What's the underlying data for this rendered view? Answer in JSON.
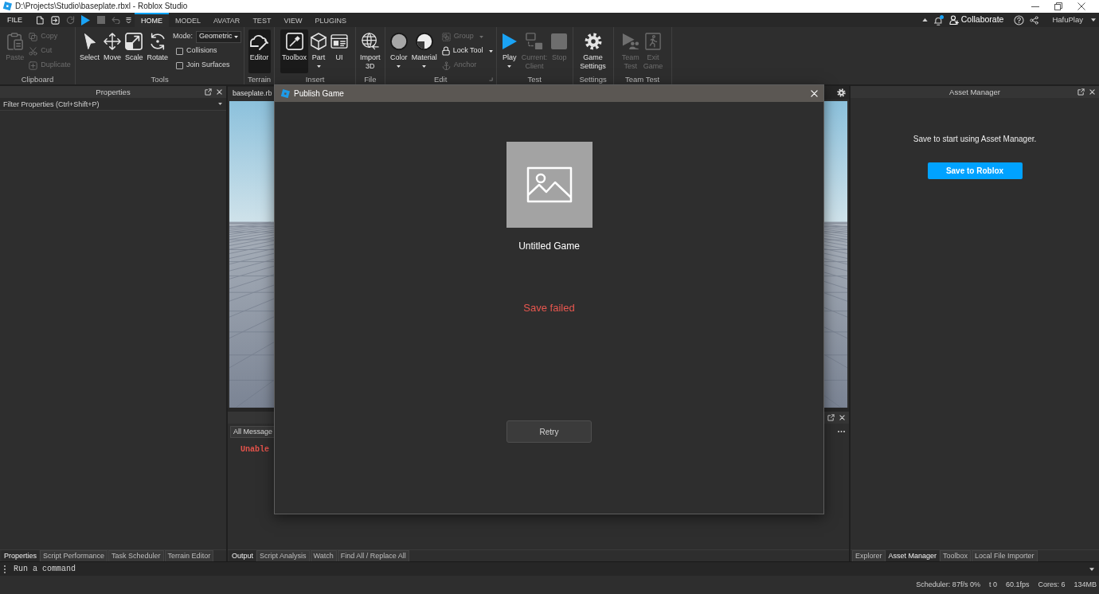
{
  "window": {
    "title": "D:\\Projects\\Studio\\baseplate.rbxl - Roblox Studio"
  },
  "menu_bar": {
    "file_menu": "FILE",
    "quick_access": [
      {
        "disabled": false
      },
      {
        "disabled": false
      },
      {
        "disabled": true
      },
      {
        "disabled": false
      },
      {
        "disabled": true
      },
      {
        "disabled": true
      },
      {
        "disabled": false
      }
    ],
    "tabs": [
      {
        "label": "HOME",
        "selected": true
      },
      {
        "label": "MODEL",
        "selected": false
      },
      {
        "label": "AVATAR",
        "selected": false
      },
      {
        "label": "TEST",
        "selected": false
      },
      {
        "label": "VIEW",
        "selected": false
      },
      {
        "label": "PLUGINS",
        "selected": false
      }
    ],
    "notifications_unread": true,
    "collaborate": "Collaborate",
    "user": "HafuPlay"
  },
  "ribbon": {
    "groups": [
      {
        "label": "Clipboard",
        "launcher": false,
        "items": [
          {
            "kind": "large",
            "label": "Paste",
            "disabled": true,
            "on": false,
            "dropdown": false
          },
          {
            "kind": "stack",
            "items": [
              {
                "kind": "small",
                "label": "Copy",
                "disabled": true,
                "dropdown": false
              },
              {
                "kind": "small",
                "label": "Cut",
                "disabled": true,
                "dropdown": false
              },
              {
                "kind": "small",
                "label": "Duplicate",
                "disabled": true,
                "dropdown": false
              }
            ]
          }
        ]
      },
      {
        "label": "Tools",
        "launcher": false,
        "items": [
          {
            "kind": "large",
            "label": "Select",
            "disabled": false,
            "on": false,
            "dropdown": false
          },
          {
            "kind": "large",
            "label": "Move",
            "disabled": false,
            "on": false,
            "dropdown": false
          },
          {
            "kind": "large",
            "label": "Scale",
            "disabled": false,
            "on": false,
            "dropdown": false
          },
          {
            "kind": "large",
            "label": "Rotate",
            "disabled": false,
            "on": false,
            "dropdown": false
          },
          {
            "kind": "stack",
            "items": [
              {
                "kind": "select",
                "label": "Mode:",
                "value": "Geometric"
              },
              {
                "kind": "checkbox",
                "label": "Collisions",
                "checked": false
              },
              {
                "kind": "checkbox",
                "label": "Join Surfaces",
                "checked": false
              }
            ]
          }
        ]
      },
      {
        "label": "Terrain",
        "launcher": false,
        "items": [
          {
            "kind": "large",
            "label": "Editor",
            "disabled": false,
            "on": true,
            "dropdown": false
          }
        ]
      },
      {
        "label": "Insert",
        "launcher": false,
        "items": [
          {
            "kind": "large",
            "label": "Toolbox",
            "disabled": false,
            "on": true,
            "dropdown": false
          },
          {
            "kind": "large",
            "label": "Part",
            "disabled": false,
            "on": false,
            "dropdown": true
          },
          {
            "kind": "large",
            "label": "UI",
            "disabled": false,
            "on": false,
            "dropdown": false
          }
        ]
      },
      {
        "label": "File",
        "launcher": false,
        "items": [
          {
            "kind": "large",
            "label": "Import 3D",
            "disabled": false,
            "on": false
          }
        ]
      },
      {
        "label": "Edit",
        "launcher": true,
        "items": [
          {
            "kind": "large",
            "label": "Color",
            "disabled": false,
            "on": false,
            "dropdown": true
          },
          {
            "kind": "large",
            "label": "Material",
            "disabled": false,
            "on": false,
            "dropdown": true
          },
          {
            "kind": "stack",
            "items": [
              {
                "kind": "small",
                "label": "Group",
                "disabled": true,
                "dropdown": true
              },
              {
                "kind": "small",
                "label": "Lock Tool",
                "disabled": false,
                "dropdown": true
              },
              {
                "kind": "small",
                "label": "Anchor",
                "disabled": true,
                "dropdown": false
              }
            ]
          }
        ]
      },
      {
        "label": "Test",
        "launcher": false,
        "items": [
          {
            "kind": "large",
            "label": "Play",
            "disabled": false,
            "on": false,
            "dropdown": true
          },
          {
            "kind": "large",
            "label": "Current: Client",
            "disabled": true,
            "on": false,
            "dropdown": false
          },
          {
            "kind": "large",
            "label": "Stop",
            "disabled": true,
            "on": false,
            "dropdown": false
          }
        ]
      },
      {
        "label": "Settings",
        "launcher": false,
        "items": [
          {
            "kind": "large",
            "label": "Game Settings",
            "disabled": false,
            "on": false
          }
        ]
      },
      {
        "label": "Team Test",
        "launcher": false,
        "items": [
          {
            "kind": "large",
            "label": "Team Test",
            "disabled": true,
            "on": false
          },
          {
            "kind": "large",
            "label": "Exit Game",
            "disabled": true,
            "on": false
          }
        ]
      }
    ]
  },
  "properties_panel": {
    "title": "Properties",
    "filter_placeholder": "Filter Properties (Ctrl+Shift+P)",
    "tabs": [
      {
        "label": "Properties",
        "selected": true
      },
      {
        "label": "Script Performance",
        "selected": false
      },
      {
        "label": "Task Scheduler",
        "selected": false
      },
      {
        "label": "Terrain Editor",
        "selected": false
      }
    ]
  },
  "viewport": {
    "tab": "baseplate.rb"
  },
  "output_panel": {
    "filter": "All Message",
    "messages": [
      {
        "kind": "error",
        "text": "Unable"
      }
    ],
    "tabs": [
      {
        "label": "Output",
        "selected": true
      },
      {
        "label": "Script Analysis",
        "selected": false
      },
      {
        "label": "Watch",
        "selected": false
      },
      {
        "label": "Find All / Replace All",
        "selected": false
      }
    ]
  },
  "asset_manager": {
    "title": "Asset Manager",
    "message": "Save to start using Asset Manager.",
    "button": "Save to Roblox",
    "tabs": [
      {
        "label": "Explorer",
        "selected": false
      },
      {
        "label": "Asset Manager",
        "selected": true
      },
      {
        "label": "Toolbox",
        "selected": false
      },
      {
        "label": "Local File Importer",
        "selected": false
      }
    ]
  },
  "command_bar": {
    "placeholder": "Run a command"
  },
  "status_bar": {
    "items": [
      "Scheduler: 87f/s 0%",
      "t 0",
      "60.1fps",
      "Cores: 6",
      "134MB"
    ]
  },
  "dialog": {
    "title": "Publish Game",
    "game_name": "Untitled Game",
    "error": "Save failed",
    "button": "Retry"
  }
}
